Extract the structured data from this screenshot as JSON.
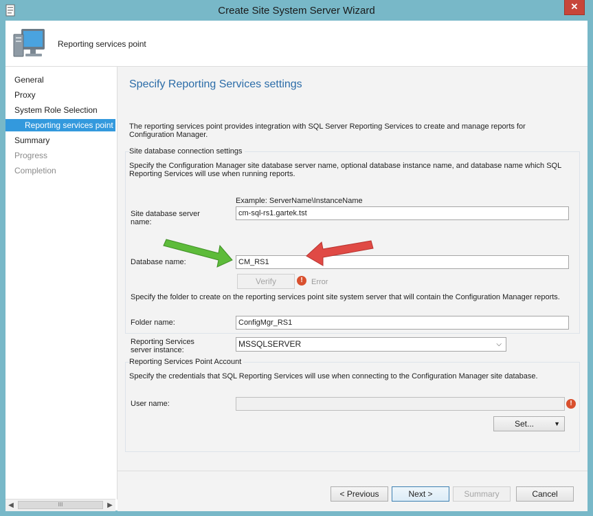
{
  "window": {
    "title": "Create Site System Server Wizard",
    "close_glyph": "✕"
  },
  "header": {
    "title": "Reporting services point"
  },
  "nav": {
    "items": [
      {
        "label": "General",
        "state": "normal"
      },
      {
        "label": "Proxy",
        "state": "normal"
      },
      {
        "label": "System Role Selection",
        "state": "normal"
      },
      {
        "label": "Reporting services point",
        "state": "selected"
      },
      {
        "label": "Summary",
        "state": "normal"
      },
      {
        "label": "Progress",
        "state": "disabled"
      },
      {
        "label": "Completion",
        "state": "disabled"
      }
    ],
    "scroll_thumb_glyph": "III"
  },
  "main": {
    "heading": "Specify Reporting Services settings",
    "intro": "The reporting services point provides integration with SQL Server Reporting Services to create and manage reports for Configuration Manager.",
    "db_group": {
      "label": "Site database connection settings",
      "description": "Specify the Configuration Manager site database server name, optional database instance name, and database name which SQL Reporting Services will use when running reports.",
      "example": "Example: ServerName\\InstanceName",
      "server_label": "Site database server name:",
      "server_value": "cm-sql-rs1.gartek.tst",
      "dbname_label": "Database name:",
      "dbname_value": "CM_RS1",
      "verify_label": "Verify",
      "error_label": "Error",
      "folder_description": "Specify the folder to create on the reporting services point site system server that will contain the Configuration Manager reports.",
      "folder_label": "Folder name:",
      "folder_value": "ConfigMgr_RS1"
    },
    "instance_label": "Reporting Services server instance:",
    "instance_value": "MSSQLSERVER",
    "account_group": {
      "label": "Reporting Services Point Account",
      "description": "Specify the credentials that SQL Reporting Services will use when connecting to the Configuration Manager site database.",
      "user_label": "User name:",
      "user_value": "",
      "set_label": "Set..."
    }
  },
  "footer": {
    "previous": "< Previous",
    "next": "Next >",
    "summary": "Summary",
    "cancel": "Cancel"
  },
  "colors": {
    "title_bar": "#78b8c8",
    "selected_nav": "#3399dd",
    "heading": "#2b6ca8",
    "close_button": "#c7463a",
    "error_icon": "#d9502e",
    "green_arrow": "#5dbb3a",
    "red_arrow": "#e04a45"
  }
}
